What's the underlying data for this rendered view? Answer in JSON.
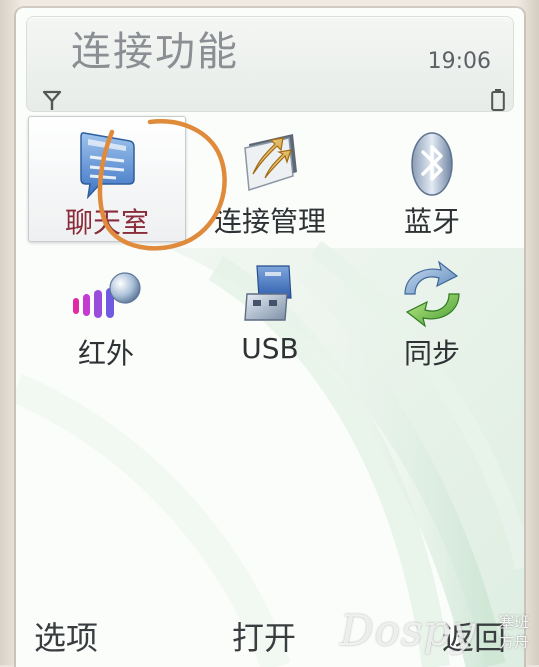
{
  "header": {
    "title": "连接功能",
    "time": "19:06"
  },
  "status": {
    "signal_icon": "signal-antenna-icon",
    "battery_icon": "battery-icon"
  },
  "grid": {
    "items": [
      {
        "label": "聊天室",
        "icon": "chat-bubble-icon",
        "selected": true
      },
      {
        "label": "连接管理",
        "icon": "connection-manager-icon",
        "selected": false
      },
      {
        "label": "蓝牙",
        "icon": "bluetooth-icon",
        "selected": false
      },
      {
        "label": "红外",
        "icon": "infrared-icon",
        "selected": false
      },
      {
        "label": "USB",
        "icon": "usb-icon",
        "selected": false
      },
      {
        "label": "同步",
        "icon": "sync-icon",
        "selected": false
      }
    ]
  },
  "softkeys": {
    "left": "选项",
    "middle": "打开",
    "right": "返回"
  },
  "watermark": {
    "text": "Dospy",
    "subtext": "塞班 方舟"
  },
  "colors": {
    "selected_label": "#8a2b3a",
    "annotation_circle": "#e08a3c"
  }
}
